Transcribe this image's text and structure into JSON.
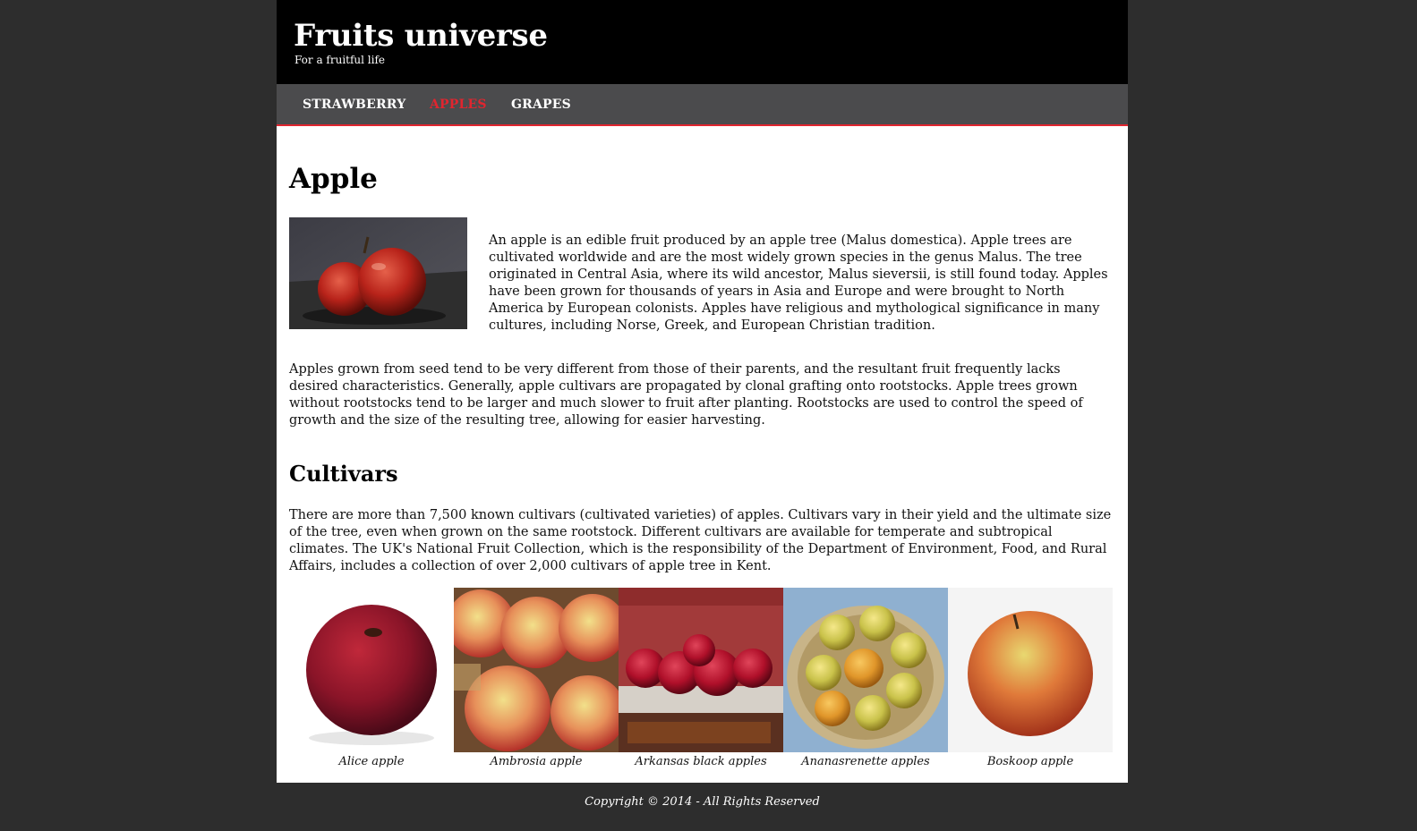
{
  "header": {
    "title": "Fruits universe",
    "tagline": "For a fruitful life"
  },
  "nav": {
    "items": [
      {
        "label": "STRAWBERRY",
        "active": false
      },
      {
        "label": "APPLES",
        "active": true
      },
      {
        "label": "GRAPES",
        "active": false
      }
    ]
  },
  "main": {
    "heading": "Apple",
    "paragraphs": [
      "An apple is an edible fruit produced by an apple tree (Malus domestica). Apple trees are cultivated worldwide and are the most widely grown species in the genus Malus. The tree originated in Central Asia, where its wild ancestor, Malus sieversii, is still found today. Apples have been grown for thousands of years in Asia and Europe and were brought to North America by European colonists. Apples have religious and mythological significance in many cultures, including Norse, Greek, and European Christian tradition.",
      "Apples grown from seed tend to be very different from those of their parents, and the resultant fruit frequently lacks desired characteristics. Generally, apple cultivars are propagated by clonal grafting onto rootstocks. Apple trees grown without rootstocks tend to be larger and much slower to fruit after planting. Rootstocks are used to control the speed of growth and the size of the resulting tree, allowing for easier harvesting."
    ],
    "subheading": "Cultivars",
    "cultivars_paragraph": "There are more than 7,500 known cultivars (cultivated varieties) of apples. Cultivars vary in their yield and the ultimate size of the tree, even when grown on the same rootstock. Different cultivars are available for temperate and subtropical climates. The UK's National Fruit Collection, which is the responsibility of the Department of Environment, Food, and Rural Affairs, includes a collection of over 2,000 cultivars of apple tree in Kent."
  },
  "gallery": [
    {
      "caption": "Alice apple"
    },
    {
      "caption": "Ambrosia apple"
    },
    {
      "caption": "Arkansas black apples"
    },
    {
      "caption": "Ananasrenette apples"
    },
    {
      "caption": "Boskoop apple"
    }
  ],
  "footer": {
    "copyright": "Copyright © 2014 - All Rights Reserved"
  },
  "colors": {
    "background": "#2d2d2d",
    "header": "#000000",
    "nav": "#4b4b4d",
    "accent": "#e0252f"
  }
}
